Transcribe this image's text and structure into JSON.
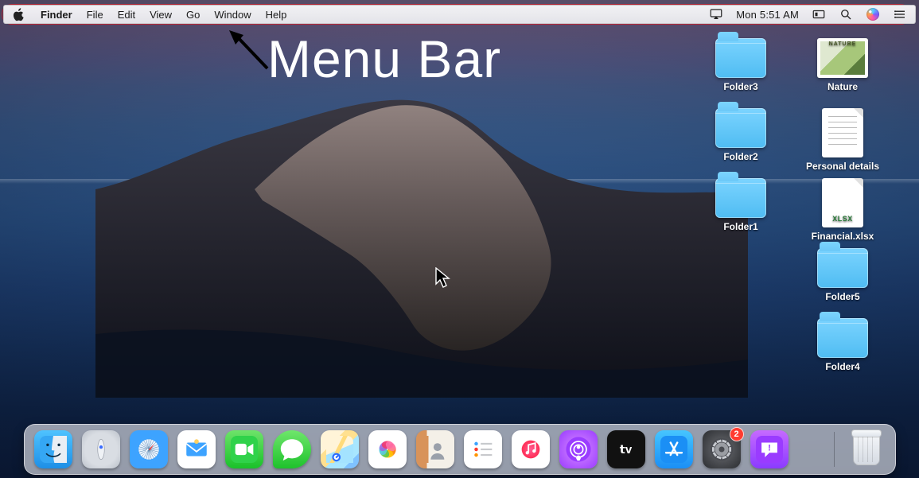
{
  "menubar": {
    "app_name": "Finder",
    "items": [
      "File",
      "Edit",
      "View",
      "Go",
      "Window",
      "Help"
    ],
    "clock": "Mon 5:51 AM"
  },
  "annotation": {
    "title": "Menu Bar"
  },
  "desktop": {
    "icons": [
      {
        "name": "Folder3",
        "kind": "folder",
        "col": 0,
        "row": 0
      },
      {
        "name": "Nature",
        "kind": "nature",
        "col": 1,
        "row": 0
      },
      {
        "name": "Folder2",
        "kind": "folder",
        "col": 0,
        "row": 1
      },
      {
        "name": "Personal details",
        "kind": "paper-lines",
        "col": 1,
        "row": 1
      },
      {
        "name": "Folder1",
        "kind": "folder",
        "col": 0,
        "row": 2
      },
      {
        "name": "Financial.xlsx",
        "kind": "paper-xlsx",
        "col": 1,
        "row": 2
      },
      {
        "name": "Folder5",
        "kind": "folder",
        "col": 1,
        "row": 3
      },
      {
        "name": "Folder4",
        "kind": "folder",
        "col": 1,
        "row": 4
      }
    ]
  },
  "dock": {
    "apps": [
      {
        "id": "finder",
        "label": "Finder"
      },
      {
        "id": "launchpad",
        "label": "Launchpad"
      },
      {
        "id": "safari",
        "label": "Safari"
      },
      {
        "id": "mail",
        "label": "Mail"
      },
      {
        "id": "facetime",
        "label": "FaceTime"
      },
      {
        "id": "messages",
        "label": "Messages"
      },
      {
        "id": "maps",
        "label": "Maps"
      },
      {
        "id": "photos",
        "label": "Photos"
      },
      {
        "id": "contacts",
        "label": "Contacts"
      },
      {
        "id": "reminders",
        "label": "Reminders"
      },
      {
        "id": "music",
        "label": "Music"
      },
      {
        "id": "podcasts",
        "label": "Podcasts"
      },
      {
        "id": "tv",
        "label": "TV",
        "text": "𝘁v"
      },
      {
        "id": "appstore",
        "label": "App Store"
      },
      {
        "id": "settings",
        "label": "System Preferences",
        "badge": "2"
      },
      {
        "id": "feedback",
        "label": "Feedback Assistant"
      }
    ],
    "trash_label": "Trash"
  }
}
